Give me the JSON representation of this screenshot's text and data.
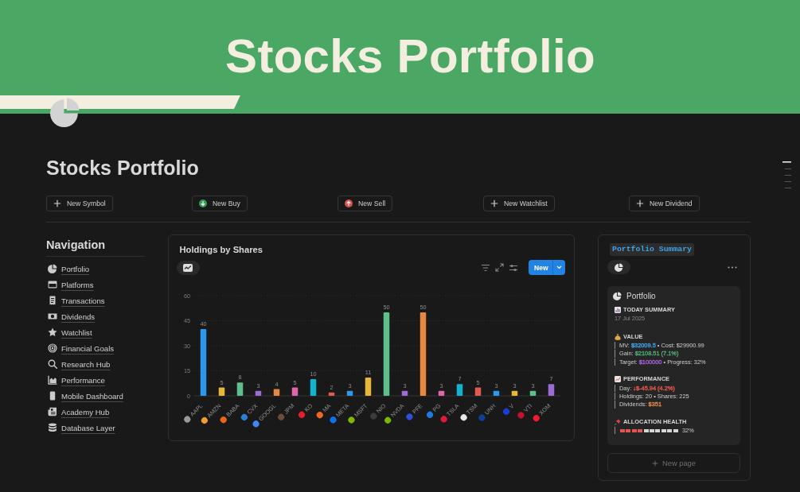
{
  "cover": {
    "title": "Stocks Portfolio"
  },
  "page_title": "Stocks Portfolio",
  "actions": [
    {
      "label": "New Symbol"
    },
    {
      "label": "New Buy"
    },
    {
      "label": "New Sell"
    },
    {
      "label": "New Watchlist"
    },
    {
      "label": "New Dividend"
    }
  ],
  "navigation": {
    "heading": "Navigation",
    "items": [
      {
        "label": "Portfolio"
      },
      {
        "label": "Platforms"
      },
      {
        "label": "Transactions"
      },
      {
        "label": "Dividends"
      },
      {
        "label": "Watchlist"
      },
      {
        "label": "Financial Goals"
      },
      {
        "label": "Research Hub"
      },
      {
        "label": "Performance"
      },
      {
        "label": "Mobile Dashboard"
      },
      {
        "label": "Academy Hub"
      },
      {
        "label": "Database Layer"
      }
    ]
  },
  "holdings": {
    "title": "Holdings by Shares",
    "new_button": "New",
    "chart_data": {
      "type": "bar",
      "categories": [
        "AAPL",
        "AMZN",
        "BABA",
        "CVX",
        "GOOGL",
        "JPM",
        "KO",
        "MA",
        "META",
        "MSFT",
        "NIO",
        "NVDA",
        "PFE",
        "PG",
        "TSLA",
        "TSM",
        "UNH",
        "V",
        "VTI",
        "XOM"
      ],
      "values": [
        40,
        5,
        8,
        3,
        4,
        5,
        10,
        2,
        3,
        11,
        50,
        3,
        50,
        3,
        7,
        5,
        3,
        3,
        3,
        7
      ],
      "ylim": [
        0,
        60
      ],
      "yticks": [
        0,
        15,
        30,
        45,
        60
      ],
      "grid": true,
      "data_labels": true
    }
  },
  "summary": {
    "title": "Portfolio Summary",
    "card": {
      "title": "Portfolio",
      "blocks": [
        {
          "kind": "heading",
          "text": "TODAY SUMMARY"
        },
        {
          "kind": "note",
          "text": "17 Jul 2025"
        },
        {
          "kind": "heading",
          "text": "VALUE"
        },
        {
          "kind": "quote",
          "parts": [
            {
              "text": "MV: "
            },
            {
              "text": "$32009.5",
              "color": "#3d9fe2"
            },
            {
              "text": " • Cost: $29900.99"
            }
          ]
        },
        {
          "kind": "quote",
          "parts": [
            {
              "text": "Gain: "
            },
            {
              "text": "$2108.51 (7.1%)",
              "color": "#4fa673"
            }
          ]
        },
        {
          "kind": "quote",
          "parts": [
            {
              "text": "Target: "
            },
            {
              "text": "$100000",
              "color": "#a25fd3"
            },
            {
              "text": " • Progress: 32%"
            }
          ]
        },
        {
          "kind": "heading",
          "text": "PERFORMANCE"
        },
        {
          "kind": "quote",
          "parts": [
            {
              "text": "Day: "
            },
            {
              "text": "↓$-45.94 (4.2%)",
              "color": "#e0564f"
            }
          ]
        },
        {
          "kind": "quote",
          "parts": [
            {
              "text": "Holdings: 20 • Shares: 225"
            }
          ]
        },
        {
          "kind": "quote",
          "parts": [
            {
              "text": "Dividends: "
            },
            {
              "text": "$351",
              "color": "#d8864a"
            }
          ]
        },
        {
          "kind": "heading",
          "text": "ALLOCATION HEALTH"
        },
        {
          "kind": "meter",
          "level": 0.4,
          "reading": "32%"
        }
      ]
    },
    "new_page": "New page"
  }
}
